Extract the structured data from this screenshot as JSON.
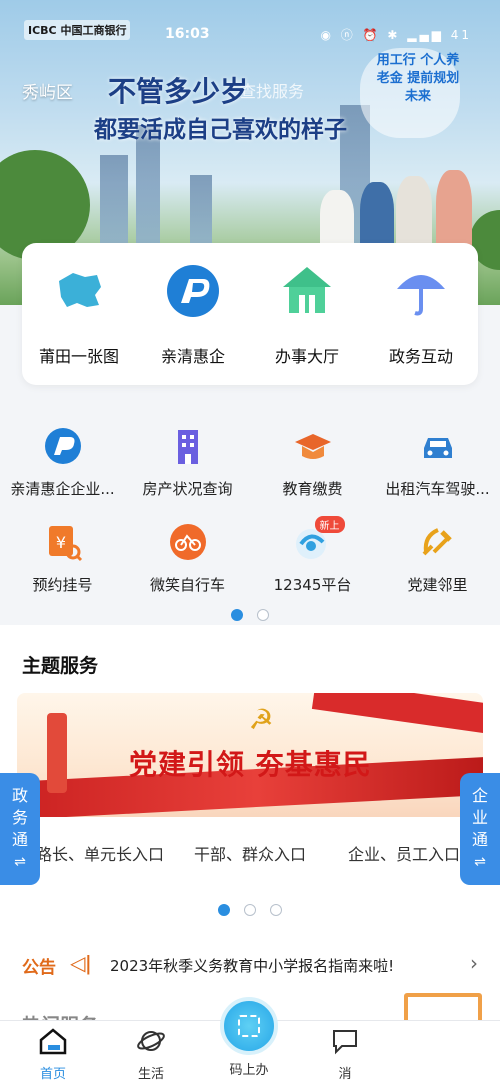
{
  "status_bar": {
    "bank": "ICBC 中国工商银行",
    "time": "16:03",
    "icons": "◉ ⓝ ⏰ ✱ ▂▄▆ 41"
  },
  "header": {
    "district": "秀屿区",
    "search_placeholder": "查找服务",
    "slogan_line1": "不管多少岁",
    "slogan_line2": "都要活成自己喜欢的样子",
    "cloud_text": "用工行 个人养老金 提前规划 未来"
  },
  "main_services": [
    {
      "label": "莆田一张图",
      "icon": "map-icon"
    },
    {
      "label": "亲清惠企",
      "icon": "qinqing-logo-icon"
    },
    {
      "label": "办事大厅",
      "icon": "hall-icon"
    },
    {
      "label": "政务互动",
      "icon": "umbrella-icon"
    }
  ],
  "quick_services": [
    {
      "label": "亲清惠企企业...",
      "icon": "qinqing-logo-icon"
    },
    {
      "label": "房产状况查询",
      "icon": "building-icon"
    },
    {
      "label": "教育缴费",
      "icon": "graduation-cap-icon"
    },
    {
      "label": "出租汽车驾驶...",
      "icon": "car-icon"
    },
    {
      "label": "预约挂号",
      "icon": "appointment-icon"
    },
    {
      "label": "微笑自行车",
      "icon": "bicycle-icon"
    },
    {
      "label": "12345平台",
      "icon": "hotline-icon",
      "badge": "新上"
    },
    {
      "label": "党建邻里",
      "icon": "party-emblem-icon"
    }
  ],
  "theme": {
    "title": "主题服务",
    "banner_text": "党建引领  夯基惠民",
    "entries": [
      "路长、单元长入口",
      "干部、群众入口",
      "企业、员工入口"
    ],
    "left_tab": "政务通",
    "right_tab": "企业通",
    "swap_glyph": "⇌"
  },
  "notice": {
    "tag": "公告",
    "text": "2023年秋季义务教育中小学报名指南来啦!",
    "arrow": "›"
  },
  "next_section_peek": "热门服务",
  "tabbar": [
    {
      "label": "首页",
      "icon": "home-icon",
      "active": true
    },
    {
      "label": "生活",
      "icon": "planet-icon",
      "active": false
    },
    {
      "label": "码上办",
      "icon": "scan-code-icon",
      "active": false
    },
    {
      "label": "消",
      "icon": "message-icon",
      "active": false
    }
  ],
  "colors": {
    "accent": "#2a8ee0",
    "notice": "#e06a1a",
    "party_red": "#d21818"
  }
}
